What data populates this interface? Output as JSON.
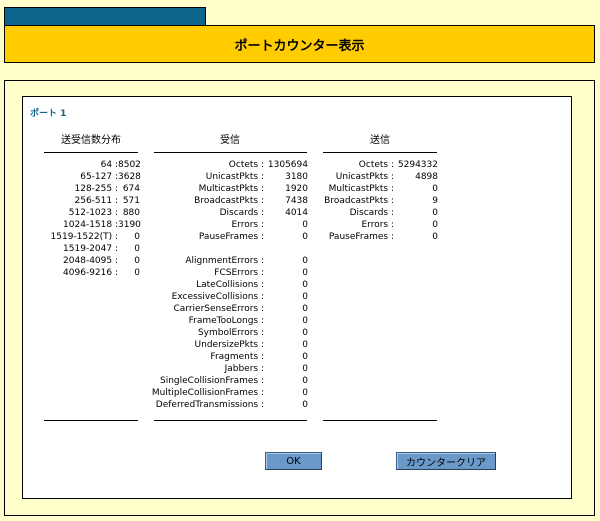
{
  "header": {
    "title": "ポートカウンター表示"
  },
  "port": {
    "label": "ポート 1"
  },
  "columns": {
    "distribution": "送受信数分布",
    "receive": "受信",
    "send": "送信"
  },
  "distribution": [
    {
      "k": "64 :",
      "v": "8502"
    },
    {
      "k": "65-127 :",
      "v": "3628"
    },
    {
      "k": "128-255 :",
      "v": "674"
    },
    {
      "k": "256-511 :",
      "v": "571"
    },
    {
      "k": "512-1023 :",
      "v": "880"
    },
    {
      "k": "1024-1518 :",
      "v": "3190"
    },
    {
      "k": "1519-1522(T) :",
      "v": "0"
    },
    {
      "k": "1519-2047 :",
      "v": "0"
    },
    {
      "k": "2048-4095 :",
      "v": "0"
    },
    {
      "k": "4096-9216 :",
      "v": "0"
    }
  ],
  "receive_basic": [
    {
      "k": "Octets :",
      "v": "1305694"
    },
    {
      "k": "UnicastPkts :",
      "v": "3180"
    },
    {
      "k": "MulticastPkts :",
      "v": "1920"
    },
    {
      "k": "BroadcastPkts :",
      "v": "7438"
    },
    {
      "k": "Discards :",
      "v": "4014"
    },
    {
      "k": "Errors :",
      "v": "0"
    },
    {
      "k": "PauseFrames :",
      "v": "0"
    }
  ],
  "receive_errors": [
    {
      "k": "AlignmentErrors :",
      "v": "0"
    },
    {
      "k": "FCSErrors :",
      "v": "0"
    },
    {
      "k": "LateCollisions :",
      "v": "0"
    },
    {
      "k": "ExcessiveCollisions :",
      "v": "0"
    },
    {
      "k": "CarrierSenseErrors :",
      "v": "0"
    },
    {
      "k": "FrameTooLongs :",
      "v": "0"
    },
    {
      "k": "SymbolErrors :",
      "v": "0"
    },
    {
      "k": "UndersizePkts :",
      "v": "0"
    },
    {
      "k": "Fragments :",
      "v": "0"
    },
    {
      "k": "Jabbers :",
      "v": "0"
    },
    {
      "k": "SingleCollisionFrames :",
      "v": "0"
    },
    {
      "k": "MultipleCollisionFrames :",
      "v": "0"
    },
    {
      "k": "DeferredTransmissions :",
      "v": "0"
    }
  ],
  "send": [
    {
      "k": "Octets :",
      "v": "5294332"
    },
    {
      "k": "UnicastPkts :",
      "v": "4898"
    },
    {
      "k": "MulticastPkts :",
      "v": "0"
    },
    {
      "k": "BroadcastPkts :",
      "v": "9"
    },
    {
      "k": "Discards :",
      "v": "0"
    },
    {
      "k": "Errors :",
      "v": "0"
    },
    {
      "k": "PauseFrames :",
      "v": "0"
    }
  ],
  "buttons": {
    "ok": "OK",
    "clear": "カウンタークリア"
  },
  "colors": {
    "header_bg": "#ffcc00",
    "tab_bg": "#0f668c",
    "page_bg": "#ffffcc",
    "button_bg": "#6a99c9"
  }
}
